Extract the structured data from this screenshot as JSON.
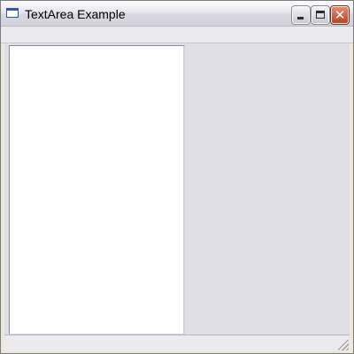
{
  "window": {
    "title": "TextArea Example",
    "close_glyph": "✕",
    "icons": {
      "app": "window-icon",
      "minimize": "minimize-icon",
      "maximize": "maximize-icon",
      "close": "close-icon",
      "resize": "resize-grip-icon"
    }
  },
  "textarea": {
    "value": ""
  },
  "colors": {
    "titlebar": "#dddce4",
    "content_background": "#e0dfe5",
    "textarea_background": "#ffffff",
    "close_button": "#c2401c"
  }
}
